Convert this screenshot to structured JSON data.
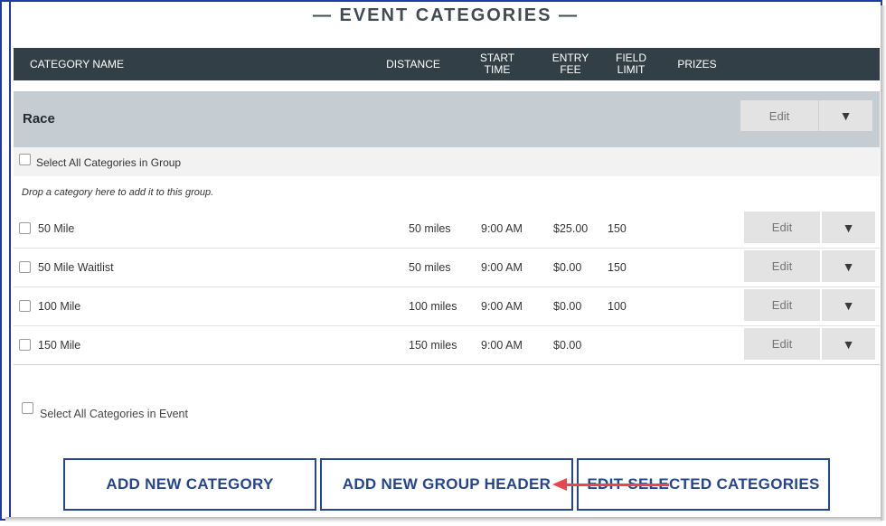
{
  "page_title": "— EVENT CATEGORIES —",
  "columns": {
    "name": "CATEGORY NAME",
    "distance": "DISTANCE",
    "start_time": "START\nTIME",
    "entry_fee": "ENTRY\nFEE",
    "field_limit": "FIELD\nLIMIT",
    "prizes": "PRIZES"
  },
  "group": {
    "name": "Race",
    "edit_label": "Edit",
    "dropdown_glyph": "▼",
    "select_all_label": "Select All Categories in Group",
    "drop_hint": "Drop a category here to add it to this group."
  },
  "categories": [
    {
      "name": "50 Mile",
      "distance": "50 miles",
      "start_time": "9:00 AM",
      "entry_fee": "$25.00",
      "field_limit": "150",
      "edit_label": "Edit",
      "dropdown_glyph": "▼"
    },
    {
      "name": "50 Mile Waitlist",
      "distance": "50 miles",
      "start_time": "9:00 AM",
      "entry_fee": "$0.00",
      "field_limit": "150",
      "edit_label": "Edit",
      "dropdown_glyph": "▼"
    },
    {
      "name": "100 Mile",
      "distance": "100 miles",
      "start_time": "9:00 AM",
      "entry_fee": "$0.00",
      "field_limit": "100",
      "edit_label": "Edit",
      "dropdown_glyph": "▼"
    },
    {
      "name": "150 Mile",
      "distance": "150 miles",
      "start_time": "9:00 AM",
      "entry_fee": "$0.00",
      "field_limit": "",
      "edit_label": "Edit",
      "dropdown_glyph": "▼"
    }
  ],
  "select_all_event_label": "Select All Categories in Event",
  "buttons": {
    "add_category": "ADD NEW CATEGORY",
    "add_group_header": "ADD NEW GROUP HEADER",
    "edit_selected": "EDIT SELECTED CATEGORIES"
  },
  "colors": {
    "header_bg": "#333f46",
    "group_bg": "#c5ccd2",
    "button_blue": "#25468f",
    "arrow_red": "#e8464e"
  }
}
